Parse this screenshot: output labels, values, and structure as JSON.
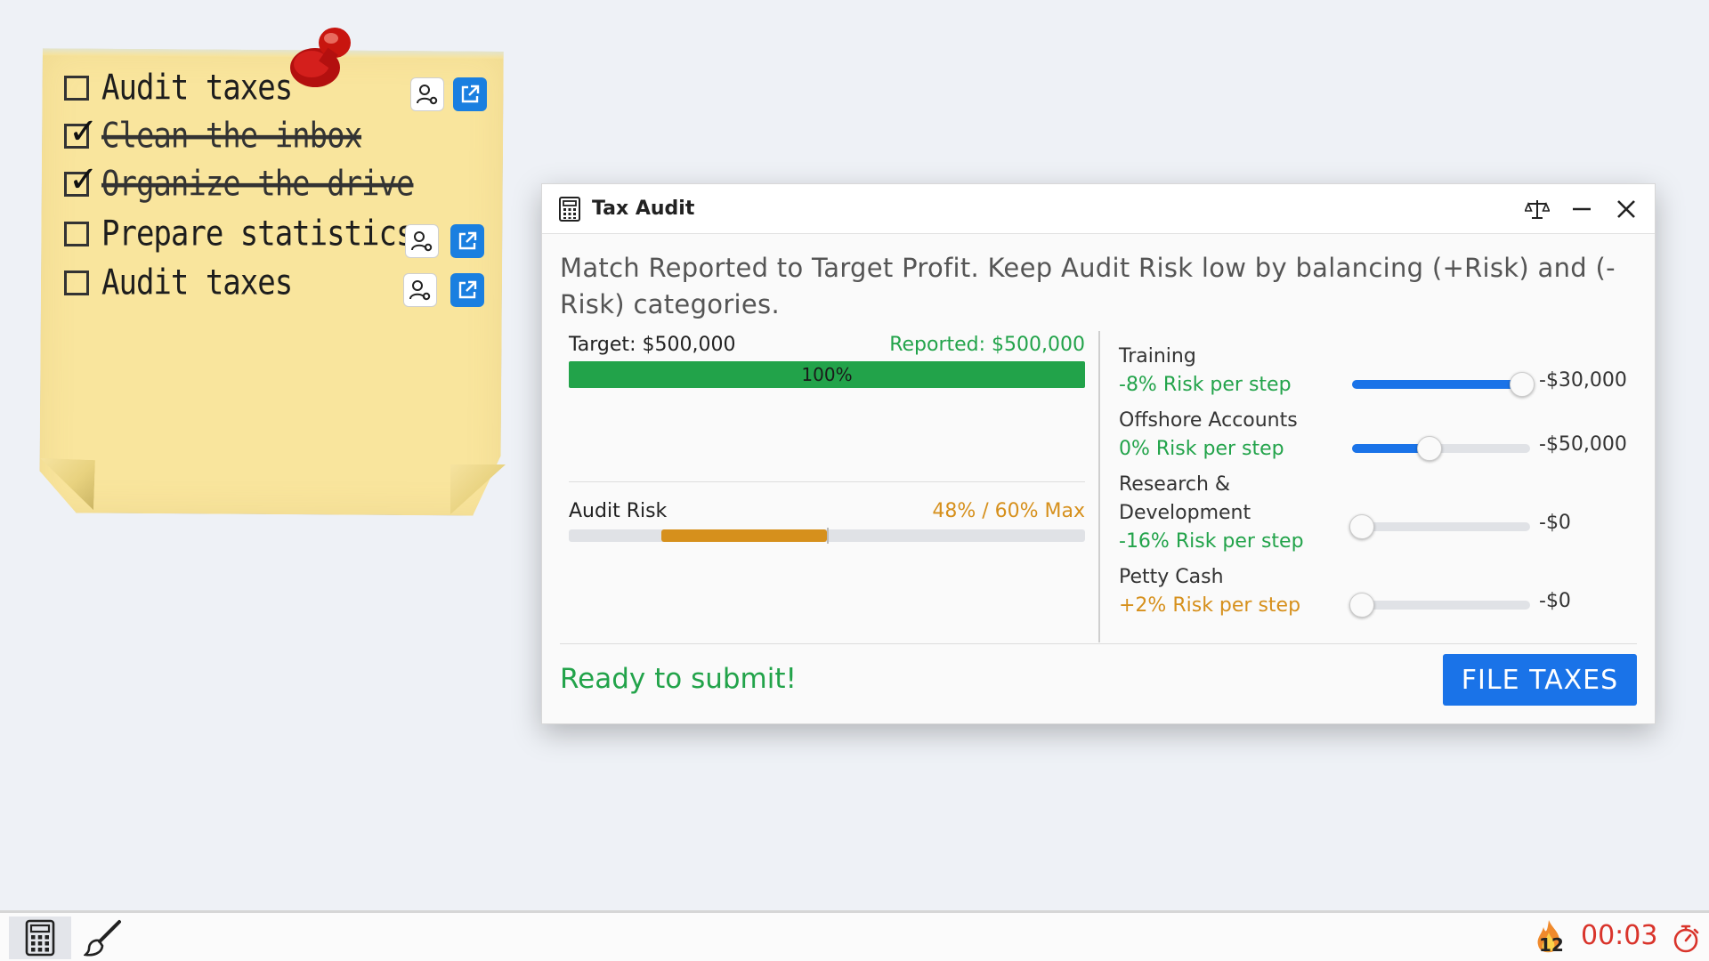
{
  "sticky_note": {
    "items": [
      {
        "label": "Audit taxes",
        "checked": false
      },
      {
        "label": "Clean the inbox",
        "checked": true
      },
      {
        "label": "Organize the drive",
        "checked": true
      },
      {
        "label": "Prepare statistics",
        "checked": false
      },
      {
        "label": "Audit taxes",
        "checked": false
      }
    ],
    "check_glyph": "✓"
  },
  "window": {
    "title": "Tax Audit",
    "instructions": "Match Reported to Target Profit. Keep Audit Risk low by balancing (+Risk) and (-Risk) categories.",
    "target_label": "Target: $500,000",
    "reported_label": "Reported: $500,000",
    "progress_text": "100%",
    "progress_value": 1.0,
    "risk_label": "Audit Risk",
    "risk_value_text": "48% / 60% Max",
    "risk_value": 0.48,
    "risk_max": 0.6,
    "categories": [
      {
        "name": "Training",
        "risk_text": "-8% Risk per step",
        "risk_color": "#22a34a",
        "value_text": "-$30,000",
        "slider_fraction": 1.0
      },
      {
        "name": "Offshore Accounts",
        "risk_text": "0% Risk per step",
        "risk_color": "#22a34a",
        "value_text": "-$50,000",
        "slider_fraction": 0.42
      },
      {
        "name": "Research & Development",
        "risk_text": "-16% Risk per step",
        "risk_color": "#22a34a",
        "value_text": "-$0",
        "slider_fraction": 0.0
      },
      {
        "name": "Petty Cash",
        "risk_text": "+2% Risk per step",
        "risk_color": "#d6901c",
        "value_text": "-$0",
        "slider_fraction": 0.0
      }
    ],
    "status": "Ready to submit!",
    "file_button": "FILE TAXES"
  },
  "taskbar": {
    "streak_count": "12",
    "timer": "00:03"
  },
  "colors": {
    "accent": "#1a73e8",
    "success": "#22a34a",
    "warning": "#d6901c",
    "timer": "#d9342b"
  }
}
